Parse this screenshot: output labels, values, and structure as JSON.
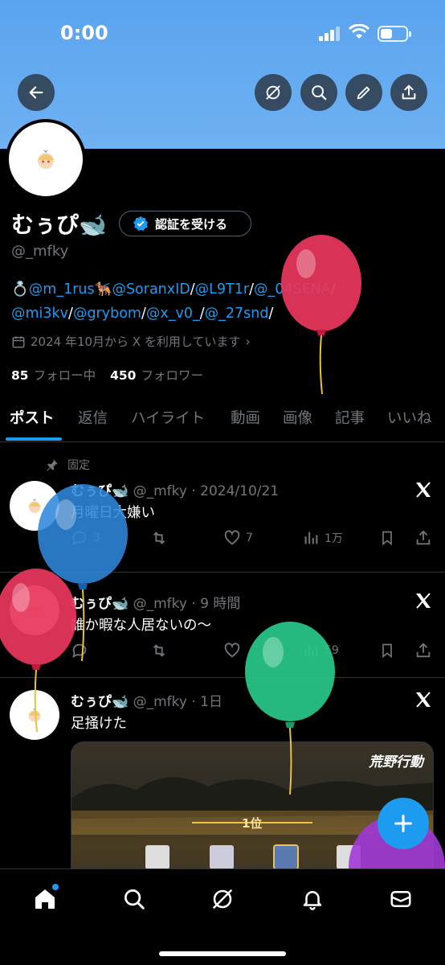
{
  "status_bar": {
    "time": "0:00"
  },
  "profile": {
    "name": "むぅぴ🐋",
    "verify_label": "認証を受ける",
    "handle": "@_mfky",
    "bio_prefix": "💍",
    "bio_links": [
      "@m_1rus",
      "@SoranxID",
      "@L9T1r",
      "@_04SENA",
      "@mi3kv",
      "@grybom",
      "@x_v0_",
      "@_27snd"
    ],
    "bio_emoji_2": "🐕‍🦺",
    "joined": "2024 年10月から X を利用しています",
    "following_count": "85",
    "following_label": "フォロー中",
    "followers_count": "450",
    "followers_label": "フォロワー"
  },
  "tabs": [
    "ポスト",
    "返信",
    "ハイライト",
    "動画",
    "画像",
    "記事",
    "いいね"
  ],
  "pinned_label": "固定",
  "tweets": [
    {
      "name": "むぅぴ🐋",
      "handle_time": "@_mfky · 2024/10/21",
      "text": "月曜日大嫌い",
      "replies": "3",
      "likes": "7",
      "views": "1万"
    },
    {
      "name": "むぅぴ🐋",
      "handle_time": "@_mfky · 9 時間",
      "text": "誰か暇な人居ないの〜",
      "views": "59"
    },
    {
      "name": "むぅぴ🐋",
      "handle_time": "@_mfky · 1日",
      "text": "足掻けた",
      "media_game_logo": "荒野行動",
      "media_rank": "1位"
    }
  ],
  "colors": {
    "accent": "#1d9bf0",
    "banner": "#6fb2f3"
  }
}
